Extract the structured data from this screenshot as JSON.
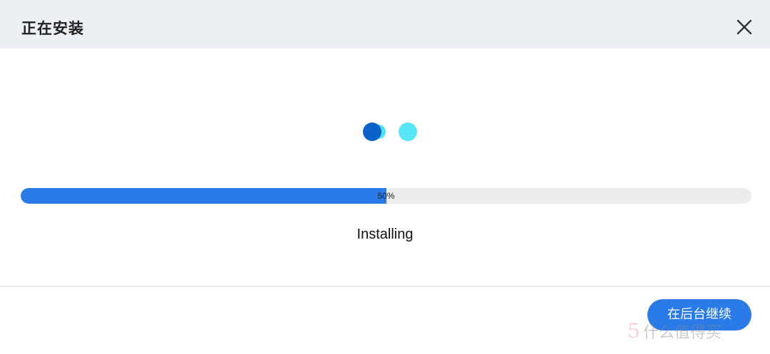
{
  "dialog": {
    "title": "正在安装",
    "close_icon": "close-icon"
  },
  "spinner": {
    "icon": "loading-dots-icon",
    "colors": [
      "#0a63c9",
      "#4fe3f5",
      "#57e6f7"
    ]
  },
  "progress": {
    "value": 0.5,
    "label": "50%",
    "fill_color": "#2a7ae8",
    "track_color": "#ececec"
  },
  "status": {
    "text": "Installing"
  },
  "footer": {
    "continue_label": "在后台继续",
    "button_color": "#2a7ae8"
  },
  "watermark": {
    "text": "5",
    "sub": "什么值得买"
  }
}
